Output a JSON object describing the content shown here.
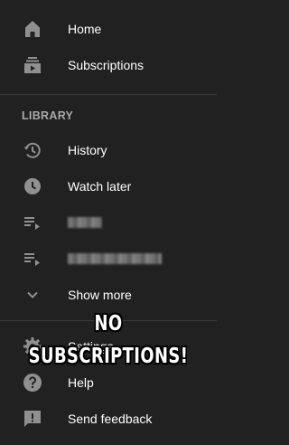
{
  "colors": {
    "background": "#212121",
    "text": "#ffffff",
    "muted_text": "#aaaaaa",
    "icon": "#909090",
    "divider": "#3a3a3a"
  },
  "nav": [
    {
      "label": "Home",
      "icon": "home-icon"
    },
    {
      "label": "Subscriptions",
      "icon": "subscriptions-icon"
    }
  ],
  "library": {
    "title": "LIBRARY",
    "items": [
      {
        "label": "History",
        "icon": "history-icon"
      },
      {
        "label": "Watch later",
        "icon": "watch-later-icon"
      },
      {
        "label": "",
        "icon": "playlist-icon",
        "blurred": true
      },
      {
        "label": "",
        "icon": "playlist-icon",
        "blurred": true
      },
      {
        "label": "Show more",
        "icon": "chevron-down-icon"
      }
    ]
  },
  "footer": [
    {
      "label": "Settings",
      "icon": "gear-icon"
    },
    {
      "label": "Help",
      "icon": "help-icon"
    },
    {
      "label": "Send feedback",
      "icon": "feedback-icon"
    }
  ],
  "overlay_text": "NO SUBSCRIPTIONS!"
}
